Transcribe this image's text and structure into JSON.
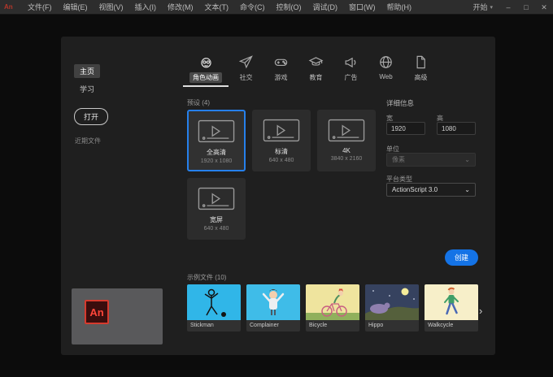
{
  "titlebar": {
    "app_icon_text": "An",
    "menus": [
      "文件(F)",
      "编辑(E)",
      "视图(V)",
      "插入(I)",
      "修改(M)",
      "文本(T)",
      "命令(C)",
      "控制(O)",
      "调试(D)",
      "窗口(W)",
      "帮助(H)"
    ],
    "workspace_label": "开始",
    "controls": {
      "minimize": "–",
      "maximize": "□",
      "close": "✕"
    }
  },
  "icons": {
    "chevron_down": "▾",
    "dropdown_chevron": "⌄",
    "next_arrow": "›"
  },
  "sidebar": {
    "items": [
      {
        "label": "主页",
        "selected": true
      },
      {
        "label": "学习",
        "selected": false
      }
    ],
    "open_button": "打开",
    "recent_label": "近期文件"
  },
  "tabs": [
    {
      "label": "角色动画",
      "selected": true
    },
    {
      "label": "社交",
      "selected": false
    },
    {
      "label": "游戏",
      "selected": false
    },
    {
      "label": "教育",
      "selected": false
    },
    {
      "label": "广告",
      "selected": false
    },
    {
      "label": "Web",
      "selected": false
    },
    {
      "label": "高级",
      "selected": false
    }
  ],
  "presets": {
    "header": "预设 (4)",
    "cards": [
      {
        "title": "全高清",
        "dimensions": "1920 x 1080",
        "selected": true
      },
      {
        "title": "标清",
        "dimensions": "640 x 480",
        "selected": false
      },
      {
        "title": "4K",
        "dimensions": "3840 x 2160",
        "selected": false
      },
      {
        "title": "宽屏",
        "dimensions": "640 x 480",
        "selected": false
      }
    ]
  },
  "details": {
    "header": "详细信息",
    "width_label": "宽",
    "width_value": "1920",
    "height_label": "高",
    "height_value": "1080",
    "units_label": "单位",
    "units_value": "像素",
    "platform_label": "平台类型",
    "platform_value": "ActionScript 3.0",
    "create_button": "创建"
  },
  "samples": {
    "header": "示例文件 (10)",
    "items": [
      {
        "name": "Stickman"
      },
      {
        "name": "Complainer"
      },
      {
        "name": "Bicycle"
      },
      {
        "name": "Hippo"
      },
      {
        "name": "Walkcycle"
      }
    ]
  },
  "colors": {
    "accent_blue": "#2680eb",
    "create_button_blue": "#1473e6",
    "logo_red": "#ff463a"
  }
}
